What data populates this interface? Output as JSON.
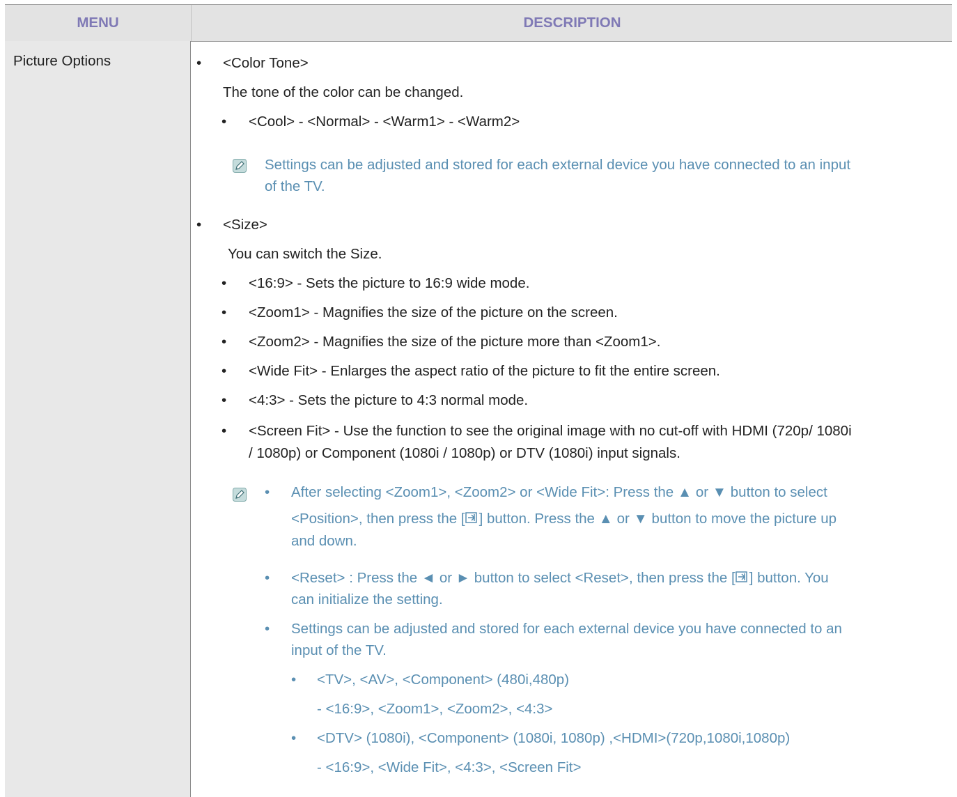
{
  "header": {
    "menu": "MENU",
    "description": "DESCRIPTION"
  },
  "menu_item": "Picture Options",
  "bullet": "•",
  "color_tone": {
    "title": "<Color Tone>",
    "desc": "The tone of the color can be changed.",
    "options": "<Cool> - <Normal> - <Warm1> - <Warm2>",
    "note_line1": "Settings can be adjusted and stored for each external device you have connected to an input",
    "note_line2": "of the TV."
  },
  "size": {
    "title": "<Size>",
    "desc": "You can switch the Size.",
    "items": [
      "<16:9> - Sets the picture to 16:9 wide mode.",
      "<Zoom1> - Magnifies the size of the picture on the screen.",
      "<Zoom2> - Magnifies the size of the picture more than <Zoom1>.",
      "<Wide Fit> - Enlarges the aspect ratio of the picture to fit the entire screen.",
      "<4:3> - Sets the picture to 4:3 normal mode."
    ],
    "screen_fit_line1": "<Screen Fit> - Use the function to see the original image with no cut-off with HDMI (720p/ 1080i",
    "screen_fit_line2": "/ 1080p) or Component (1080i / 1080p) or DTV (1080i) input signals.",
    "notes": {
      "n1_line1": "After selecting <Zoom1>, <Zoom2> or <Wide Fit>: Press the ▲ or ▼ button to select",
      "n1_line2a": "<Position>, then press the [",
      "n1_line2b": "] button. Press the ▲ or ▼ button to move the picture up",
      "n1_line3": "and down.",
      "n2_line1a": "<Reset> : Press the ◄ or ► button to select <Reset>, then press the [",
      "n2_line1b": "] button. You",
      "n2_line2": "can initialize the setting.",
      "n3_line1": "Settings can be adjusted and stored for each external device you have connected to an",
      "n3_line2": "input of the TV.",
      "s1": "<TV>, <AV>, <Component> (480i,480p)",
      "s1_modes": "- <16:9>, <Zoom1>, <Zoom2>, <4:3>",
      "s2": "<DTV> (1080i), <Component> (1080i, 1080p) ,<HDMI>(720p,1080i,1080p)",
      "s2_modes": "- <16:9>, <Wide Fit>, <4:3>, <Screen Fit>"
    }
  }
}
